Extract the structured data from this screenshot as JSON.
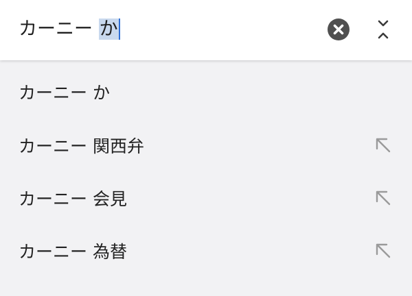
{
  "search": {
    "typed_text": "カーニー ",
    "selected_text": "か"
  },
  "icons": {
    "clear": "close-circle-icon",
    "collapse": "collapse-chevrons-icon",
    "fill_query": "arrow-up-left-icon"
  },
  "colors": {
    "selection": "#c9d9ee",
    "cursor": "#2f6fd6"
  },
  "suggestions": [
    {
      "label": "カーニー か"
    },
    {
      "label": "カーニー 関西弁"
    },
    {
      "label": "カーニー 会見"
    },
    {
      "label": "カーニー 為替"
    }
  ]
}
